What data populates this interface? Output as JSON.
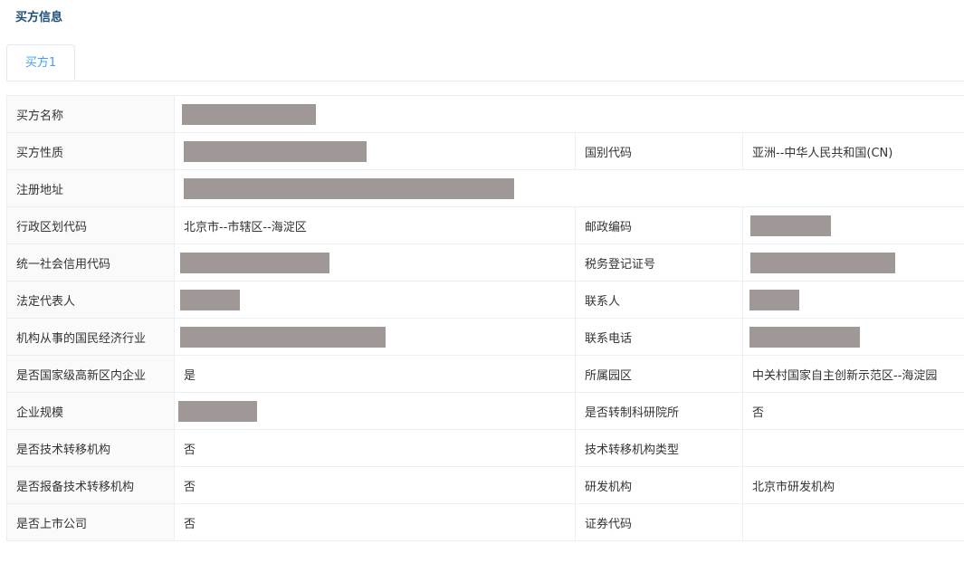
{
  "section": {
    "title": "买方信息"
  },
  "tabs": [
    {
      "label": "买方1",
      "active": true
    }
  ],
  "colors": {
    "accent": "#409eff",
    "redaction": "#a09797"
  },
  "rows": [
    {
      "label": "买方名称",
      "value": "",
      "value_redacted": true,
      "right_label": null,
      "right_value": null
    },
    {
      "label": "买方性质",
      "value": "",
      "value_redacted": true,
      "right_label": "国别代码",
      "right_value": "亚洲--中华人民共和国(CN)"
    },
    {
      "label": "注册地址",
      "value": "",
      "value_redacted": true,
      "right_label": null,
      "right_value": null
    },
    {
      "label": "行政区划代码",
      "value": "北京市--市辖区--海淀区",
      "right_label": "邮政编码",
      "right_value": "",
      "right_redacted": true
    },
    {
      "label": "统一社会信用代码",
      "value": "",
      "value_redacted": true,
      "right_label": "税务登记证号",
      "right_value": "",
      "right_redacted": true
    },
    {
      "label": "法定代表人",
      "value": "",
      "value_redacted": true,
      "right_label": "联系人",
      "right_value": "",
      "right_redacted": true
    },
    {
      "label": "机构从事的国民经济行业",
      "value": "",
      "value_redacted": true,
      "right_label": "联系电话",
      "right_value": "",
      "right_redacted": true
    },
    {
      "label": "是否国家级高新区内企业",
      "value": "是",
      "right_label": "所属园区",
      "right_value": "中关村国家自主创新示范区--海淀园"
    },
    {
      "label": "企业规模",
      "value": "",
      "value_redacted": true,
      "right_label": "是否转制科研院所",
      "right_value": "否"
    },
    {
      "label": "是否技术转移机构",
      "value": "否",
      "right_label": "技术转移机构类型",
      "right_value": ""
    },
    {
      "label": "是否报备技术转移机构",
      "value": "否",
      "right_label": "研发机构",
      "right_value": "北京市研发机构"
    },
    {
      "label": "是否上市公司",
      "value": "否",
      "right_label": "证券代码",
      "right_value": ""
    }
  ]
}
